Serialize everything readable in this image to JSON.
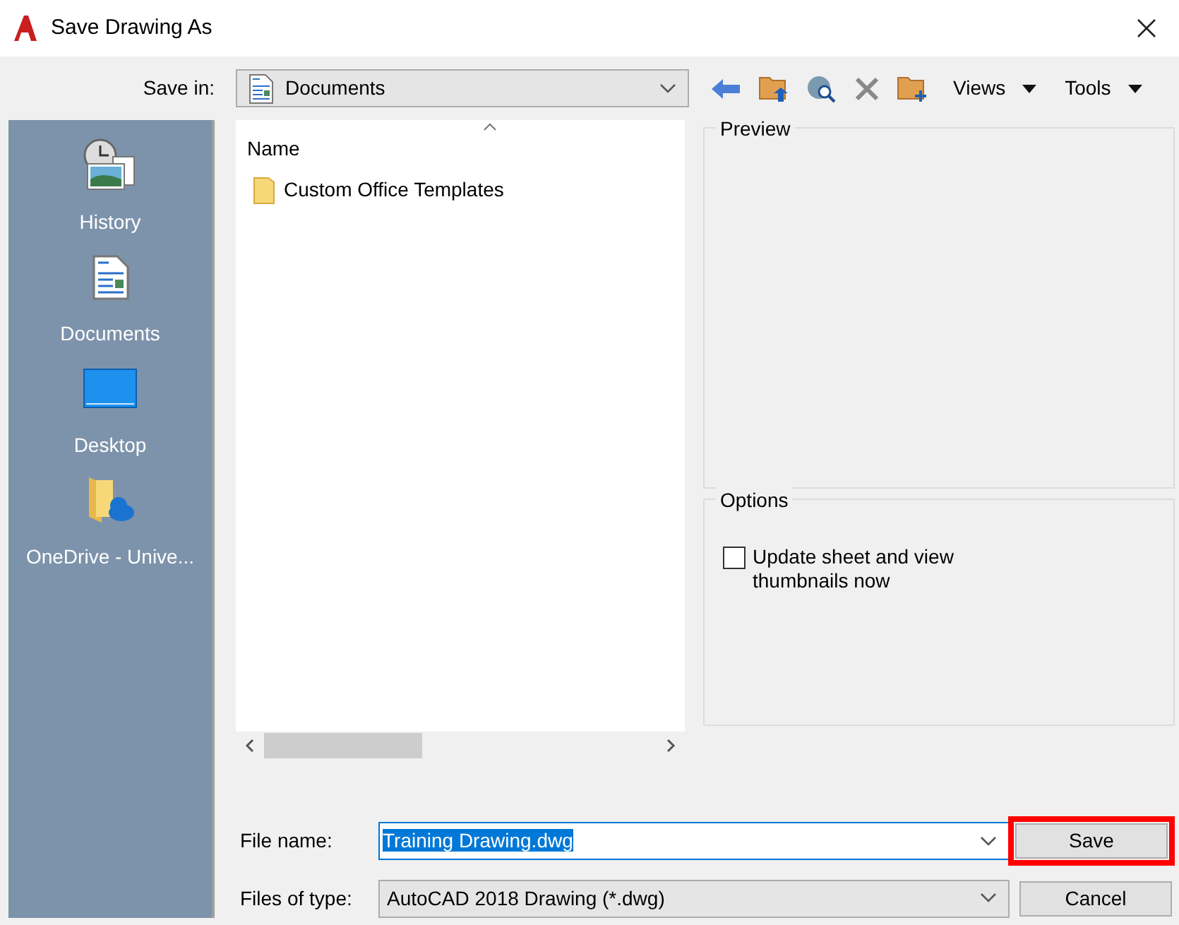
{
  "window": {
    "title": "Save Drawing As"
  },
  "save_in": {
    "label": "Save in:",
    "value": "Documents"
  },
  "toolbar": {
    "views": "Views",
    "tools": "Tools"
  },
  "places": [
    {
      "kind": "history",
      "label": "History"
    },
    {
      "kind": "documents",
      "label": "Documents"
    },
    {
      "kind": "desktop",
      "label": "Desktop"
    },
    {
      "kind": "onedrive",
      "label": "OneDrive - Unive..."
    }
  ],
  "file_list": {
    "columns": [
      "Name"
    ],
    "items": [
      {
        "kind": "folder",
        "name": "Custom Office Templates"
      }
    ]
  },
  "preview": {
    "title": "Preview"
  },
  "options": {
    "title": "Options",
    "checkboxes": [
      {
        "label": "Update sheet and view thumbnails now",
        "checked": false
      }
    ]
  },
  "file_name": {
    "label": "File name:",
    "value": "Training Drawing.dwg",
    "selected": true
  },
  "file_type": {
    "label": "Files of type:",
    "value": "AutoCAD 2018 Drawing (*.dwg)"
  },
  "buttons": [
    {
      "label": "Save",
      "highlighted": true
    },
    {
      "label": "Cancel",
      "highlighted": false
    }
  ]
}
